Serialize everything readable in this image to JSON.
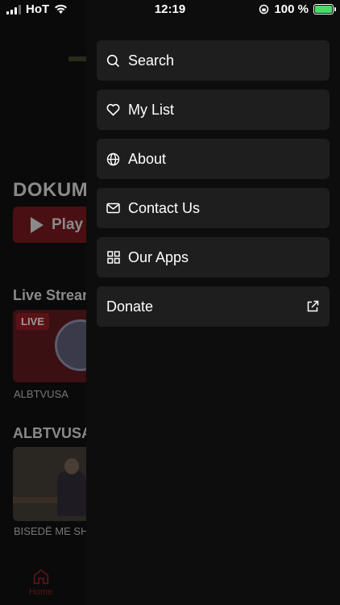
{
  "status_bar": {
    "carrier": "HoT",
    "time": "12:19",
    "battery_text": "100 %"
  },
  "background": {
    "title": "DOKUM",
    "play_label": "Play",
    "section_live": "Live Strean",
    "live_badge": "LIVE",
    "live_caption": "ALBTVUSA",
    "section_albtvusa": "ALBTVUSA",
    "video_caption": "BISEDË ME SH",
    "tab_home": "Home"
  },
  "menu": {
    "items": [
      {
        "label": "Search",
        "icon": "search-icon"
      },
      {
        "label": "My List",
        "icon": "heart-icon"
      },
      {
        "label": "About",
        "icon": "globe-icon"
      },
      {
        "label": "Contact Us",
        "icon": "mail-icon"
      },
      {
        "label": "Our Apps",
        "icon": "grid-icon"
      },
      {
        "label": "Donate",
        "icon": "external-link-icon"
      }
    ]
  },
  "colors": {
    "drawer_bg": "#0d0d0d",
    "item_bg": "#1e1e1e",
    "battery_green": "#4cd964",
    "accent_red": "#5a1217"
  }
}
